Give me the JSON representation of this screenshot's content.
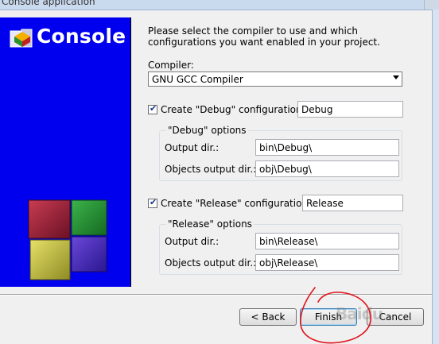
{
  "window": {
    "title": "Console application"
  },
  "banner": {
    "title": "Console",
    "logo_icon": "codeblocks-logo-icon",
    "background": "#0000ee"
  },
  "intro_text": "Please select the compiler to use and which configurations you want enabled in your project.",
  "compiler": {
    "label": "Compiler:",
    "selected": "GNU GCC Compiler"
  },
  "debug": {
    "checkbox_label": "Create \"Debug\" configuration:",
    "checked": true,
    "name_value": "Debug",
    "group_title": "\"Debug\" options",
    "output_dir_label": "Output dir.:",
    "output_dir_value": "bin\\Debug\\",
    "objects_dir_label": "Objects output dir.:",
    "objects_dir_value": "obj\\Debug\\"
  },
  "release": {
    "checkbox_label": "Create \"Release\" configuration:",
    "checked": true,
    "name_value": "Release",
    "group_title": "\"Release\" options",
    "output_dir_label": "Output dir.:",
    "output_dir_value": "bin\\Release\\",
    "objects_dir_label": "Objects output dir.:",
    "objects_dir_value": "obj\\Release\\"
  },
  "buttons": {
    "back": "< Back",
    "finish": "Finish",
    "cancel": "Cancel"
  },
  "watermark": "Baidu",
  "annotation_color": "#e0141b"
}
